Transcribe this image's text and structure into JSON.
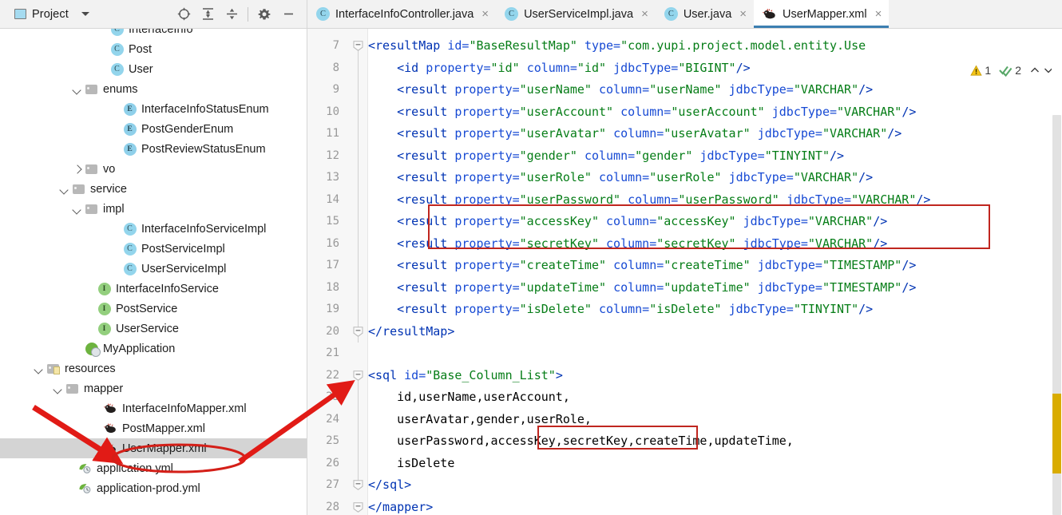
{
  "toolbar": {
    "project_label": "Project",
    "icons": [
      "locate-icon",
      "expand-all-icon",
      "collapse-all-icon",
      "settings-gear-icon",
      "minimize-icon"
    ]
  },
  "tabs": [
    {
      "label": "InterfaceInfoController.java",
      "icon": "java-class-icon",
      "glyph": "C",
      "active": false,
      "close": "×"
    },
    {
      "label": "UserServiceImpl.java",
      "icon": "java-class-icon",
      "glyph": "C",
      "active": false,
      "close": "×"
    },
    {
      "label": "User.java",
      "icon": "java-class-icon",
      "glyph": "C",
      "active": false,
      "close": "×"
    },
    {
      "label": "UserMapper.xml",
      "icon": "mybatis-bird-icon",
      "glyph": "",
      "active": true,
      "close": "×"
    }
  ],
  "tree": [
    {
      "label": "InterfaceInfo",
      "indent": 8,
      "icon": "java-class-icon",
      "glyph": "C",
      "arrow": "none",
      "selected": false
    },
    {
      "label": "Post",
      "indent": 8,
      "icon": "java-class-icon",
      "glyph": "C",
      "arrow": "none",
      "selected": false
    },
    {
      "label": "User",
      "indent": 8,
      "icon": "java-class-icon",
      "glyph": "C",
      "arrow": "none",
      "selected": false
    },
    {
      "label": "enums",
      "indent": 6,
      "icon": "folder-icon",
      "glyph": "",
      "arrow": "down",
      "selected": false
    },
    {
      "label": "InterfaceInfoStatusEnum",
      "indent": 9,
      "icon": "enum-icon",
      "glyph": "E",
      "arrow": "none",
      "selected": false
    },
    {
      "label": "PostGenderEnum",
      "indent": 9,
      "icon": "enum-icon",
      "glyph": "E",
      "arrow": "none",
      "selected": false
    },
    {
      "label": "PostReviewStatusEnum",
      "indent": 9,
      "icon": "enum-icon",
      "glyph": "E",
      "arrow": "none",
      "selected": false
    },
    {
      "label": "vo",
      "indent": 6,
      "icon": "folder-icon",
      "glyph": "",
      "arrow": "right",
      "selected": false
    },
    {
      "label": "service",
      "indent": 5,
      "icon": "folder-icon",
      "glyph": "",
      "arrow": "down",
      "selected": false
    },
    {
      "label": "impl",
      "indent": 6,
      "icon": "folder-icon",
      "glyph": "",
      "arrow": "down",
      "selected": false
    },
    {
      "label": "InterfaceInfoServiceImpl",
      "indent": 9,
      "icon": "java-class-icon",
      "glyph": "C",
      "arrow": "none",
      "selected": false
    },
    {
      "label": "PostServiceImpl",
      "indent": 9,
      "icon": "java-class-icon",
      "glyph": "C",
      "arrow": "none",
      "selected": false
    },
    {
      "label": "UserServiceImpl",
      "indent": 9,
      "icon": "java-class-icon",
      "glyph": "C",
      "arrow": "none",
      "selected": false
    },
    {
      "label": "InterfaceInfoService",
      "indent": 7,
      "icon": "interface-icon",
      "glyph": "I",
      "arrow": "none",
      "selected": false
    },
    {
      "label": "PostService",
      "indent": 7,
      "icon": "interface-icon",
      "glyph": "I",
      "arrow": "none",
      "selected": false
    },
    {
      "label": "UserService",
      "indent": 7,
      "icon": "interface-icon",
      "glyph": "I",
      "arrow": "none",
      "selected": false
    },
    {
      "label": "MyApplication",
      "indent": 6,
      "icon": "spring-boot-icon",
      "glyph": "",
      "arrow": "none",
      "selected": false
    },
    {
      "label": "resources",
      "indent": 3,
      "icon": "resources-folder-icon",
      "glyph": "",
      "arrow": "down",
      "selected": false
    },
    {
      "label": "mapper",
      "indent": 4.5,
      "icon": "folder-icon",
      "glyph": "",
      "arrow": "down",
      "selected": false
    },
    {
      "label": "InterfaceInfoMapper.xml",
      "indent": 7.5,
      "icon": "mybatis-bird-icon",
      "glyph": "",
      "arrow": "none",
      "selected": false
    },
    {
      "label": "PostMapper.xml",
      "indent": 7.5,
      "icon": "mybatis-bird-icon",
      "glyph": "",
      "arrow": "none",
      "selected": false
    },
    {
      "label": "UserMapper.xml",
      "indent": 7.5,
      "icon": "mybatis-bird-icon",
      "glyph": "",
      "arrow": "none",
      "selected": true
    },
    {
      "label": "application.yml",
      "indent": 5.5,
      "icon": "yaml-icon",
      "glyph": "",
      "arrow": "none",
      "selected": false
    },
    {
      "label": "application-prod.yml",
      "indent": 5.5,
      "icon": "yaml-icon",
      "glyph": "",
      "arrow": "none",
      "selected": false
    }
  ],
  "editor": {
    "first_line": 7,
    "inspection": {
      "warning_icon": "warning-triangle-icon",
      "warning_count": "1",
      "inspection_icon": "inspection-checkmark-icon",
      "inspection_count": "2",
      "prev_icon": "chevron-up-icon",
      "next_icon": "chevron-down-icon"
    },
    "lines": [
      {
        "n": 7,
        "fold": "collapse",
        "html": "<span class=\"tg\">&lt;resultMap</span> <span class=\"at\">id=</span><span class=\"vl\">\"BaseResultMap\"</span> <span class=\"at\">type=</span><span class=\"vl\">\"com.yupi.project.model.entity.Use</span>"
      },
      {
        "n": 8,
        "fold": "",
        "html": "    <span class=\"tg\">&lt;id</span> <span class=\"at\">property=</span><span class=\"vl\">\"id\"</span> <span class=\"at\">column=</span><span class=\"vl\">\"id\"</span> <span class=\"at\">jdbcType=</span><span class=\"vl\">\"BIGINT\"</span><span class=\"tg\">/&gt;</span>"
      },
      {
        "n": 9,
        "fold": "",
        "html": "    <span class=\"tg\">&lt;result</span> <span class=\"at\">property=</span><span class=\"vl\">\"userName\"</span> <span class=\"at\">column=</span><span class=\"vl\">\"userName\"</span> <span class=\"at\">jdbcType=</span><span class=\"vl\">\"VARCHAR\"</span><span class=\"tg\">/&gt;</span>"
      },
      {
        "n": 10,
        "fold": "",
        "html": "    <span class=\"tg\">&lt;result</span> <span class=\"at\">property=</span><span class=\"vl\">\"userAccount\"</span> <span class=\"at\">column=</span><span class=\"vl\">\"userAccount\"</span> <span class=\"at\">jdbcType=</span><span class=\"vl\">\"VARCHAR\"</span><span class=\"tg\">/&gt;</span>"
      },
      {
        "n": 11,
        "fold": "",
        "html": "    <span class=\"tg\">&lt;result</span> <span class=\"at\">property=</span><span class=\"vl\">\"userAvatar\"</span> <span class=\"at\">column=</span><span class=\"vl\">\"userAvatar\"</span> <span class=\"at\">jdbcType=</span><span class=\"vl\">\"VARCHAR\"</span><span class=\"tg\">/&gt;</span>"
      },
      {
        "n": 12,
        "fold": "",
        "html": "    <span class=\"tg\">&lt;result</span> <span class=\"at\">property=</span><span class=\"vl\">\"gender\"</span> <span class=\"at\">column=</span><span class=\"vl\">\"gender\"</span> <span class=\"at\">jdbcType=</span><span class=\"vl\">\"TINYINT\"</span><span class=\"tg\">/&gt;</span>"
      },
      {
        "n": 13,
        "fold": "",
        "html": "    <span class=\"tg\">&lt;result</span> <span class=\"at\">property=</span><span class=\"vl\">\"userRole\"</span> <span class=\"at\">column=</span><span class=\"vl\">\"userRole\"</span> <span class=\"at\">jdbcType=</span><span class=\"vl\">\"VARCHAR\"</span><span class=\"tg\">/&gt;</span>"
      },
      {
        "n": 14,
        "fold": "",
        "html": "    <span class=\"tg\">&lt;result</span> <span class=\"at\">property=</span><span class=\"vl\">\"userPassword\"</span> <span class=\"at\">column=</span><span class=\"vl\">\"userPassword\"</span> <span class=\"at\">jdbcType=</span><span class=\"vl\">\"VARCHAR\"</span><span class=\"tg\">/&gt;</span>"
      },
      {
        "n": 15,
        "fold": "",
        "html": "    <span class=\"tg\">&lt;result</span> <span class=\"at\">property=</span><span class=\"vl\">\"accessKey\"</span> <span class=\"at\">column=</span><span class=\"vl\">\"accessKey\"</span> <span class=\"at\">jdbcType=</span><span class=\"vl\">\"VARCHAR\"</span><span class=\"tg\">/&gt;</span>"
      },
      {
        "n": 16,
        "fold": "",
        "html": "    <span class=\"tg\">&lt;result</span> <span class=\"at\">property=</span><span class=\"vl\">\"secretKey\"</span> <span class=\"at\">column=</span><span class=\"vl\">\"secretKey\"</span> <span class=\"at\">jdbcType=</span><span class=\"vl\">\"VARCHAR\"</span><span class=\"tg\">/&gt;</span>"
      },
      {
        "n": 17,
        "fold": "",
        "html": "    <span class=\"tg\">&lt;result</span> <span class=\"at\">property=</span><span class=\"vl\">\"createTime\"</span> <span class=\"at\">column=</span><span class=\"vl\">\"createTime\"</span> <span class=\"at\">jdbcType=</span><span class=\"vl\">\"TIMESTAMP\"</span><span class=\"tg\">/&gt;</span>"
      },
      {
        "n": 18,
        "fold": "",
        "html": "    <span class=\"tg\">&lt;result</span> <span class=\"at\">property=</span><span class=\"vl\">\"updateTime\"</span> <span class=\"at\">column=</span><span class=\"vl\">\"updateTime\"</span> <span class=\"at\">jdbcType=</span><span class=\"vl\">\"TIMESTAMP\"</span><span class=\"tg\">/&gt;</span>"
      },
      {
        "n": 19,
        "fold": "",
        "html": "    <span class=\"tg\">&lt;result</span> <span class=\"at\">property=</span><span class=\"vl\">\"isDelete\"</span> <span class=\"at\">column=</span><span class=\"vl\">\"isDelete\"</span> <span class=\"at\">jdbcType=</span><span class=\"vl\">\"TINYINT\"</span><span class=\"tg\">/&gt;</span>"
      },
      {
        "n": 20,
        "fold": "collapse",
        "html": "<span class=\"tg\">&lt;/resultMap&gt;</span>"
      },
      {
        "n": 21,
        "fold": "",
        "html": ""
      },
      {
        "n": 22,
        "fold": "collapse",
        "html": "<span class=\"tg\">&lt;sql</span> <span class=\"at\">id=</span><span class=\"vl\">\"Base_Column_List\"</span><span class=\"tg\">&gt;</span>"
      },
      {
        "n": 23,
        "fold": "",
        "html": "    id,userName,userAccount,"
      },
      {
        "n": 24,
        "fold": "",
        "html": "    userAvatar,gender,userRole,"
      },
      {
        "n": 25,
        "fold": "",
        "html": "    userPassword,accessKey,secretKey,createTime,updateTime,"
      },
      {
        "n": 26,
        "fold": "",
        "html": "    isDelete"
      },
      {
        "n": 27,
        "fold": "collapse",
        "html": "<span class=\"tg\">&lt;/sql&gt;</span>"
      },
      {
        "n": 28,
        "fold": "collapse",
        "html": "<span class=\"tg\">&lt;/mapper&gt;</span>"
      }
    ],
    "code_text": {
      "line7": "<resultMap id=\"BaseResultMap\" type=\"com.yupi.project.model.entity.Use",
      "line8": "<id property=\"id\" column=\"id\" jdbcType=\"BIGINT\"/>",
      "line9": "<result property=\"userName\" column=\"userName\" jdbcType=\"VARCHAR\"/>",
      "line10": "<result property=\"userAccount\" column=\"userAccount\" jdbcType=\"VARCHAR\"/>",
      "line11": "<result property=\"userAvatar\" column=\"userAvatar\" jdbcType=\"VARCHAR\"/>",
      "line12": "<result property=\"gender\" column=\"gender\" jdbcType=\"TINYINT\"/>",
      "line13": "<result property=\"userRole\" column=\"userRole\" jdbcType=\"VARCHAR\"/>",
      "line14": "<result property=\"userPassword\" column=\"userPassword\" jdbcType=\"VARCHAR\"/>",
      "line15": "<result property=\"accessKey\" column=\"accessKey\" jdbcType=\"VARCHAR\"/>",
      "line16": "<result property=\"secretKey\" column=\"secretKey\" jdbcType=\"VARCHAR\"/>",
      "line17": "<result property=\"createTime\" column=\"createTime\" jdbcType=\"TIMESTAMP\"/>",
      "line18": "<result property=\"updateTime\" column=\"updateTime\" jdbcType=\"TIMESTAMP\"/>",
      "line19": "<result property=\"isDelete\" column=\"isDelete\" jdbcType=\"TINYINT\"/>",
      "line20": "</resultMap>",
      "line22": "<sql id=\"Base_Column_List\">",
      "line23": "id,userName,userAccount,",
      "line24": "userAvatar,gender,userRole,",
      "line25": "userPassword,accessKey,secretKey,createTime,updateTime,",
      "line26": "isDelete",
      "line27": "</sql>",
      "line28": "</mapper>"
    }
  },
  "annotations": {
    "highlight_color": "#c0261f",
    "boxes": [
      {
        "name": "accesskey-secretkey-resultmap-box"
      },
      {
        "name": "accesskey-secretkey-columnlist-box"
      }
    ],
    "ellipse": {
      "name": "usermapper-xml-ellipse"
    },
    "arrows": [
      {
        "name": "arrow-to-usermapper-file"
      },
      {
        "name": "arrow-to-sql-block"
      }
    ]
  },
  "colors": {
    "tag": "#0033b3",
    "attribute": "#174ad4",
    "value": "#067d17",
    "sql_highlight": "#f5e8c0",
    "selection": "#d4d4d4",
    "tab_underline": "#3c7fb1",
    "annotation_red": "#c0261f",
    "scroll_marker": "#d9ac00"
  }
}
